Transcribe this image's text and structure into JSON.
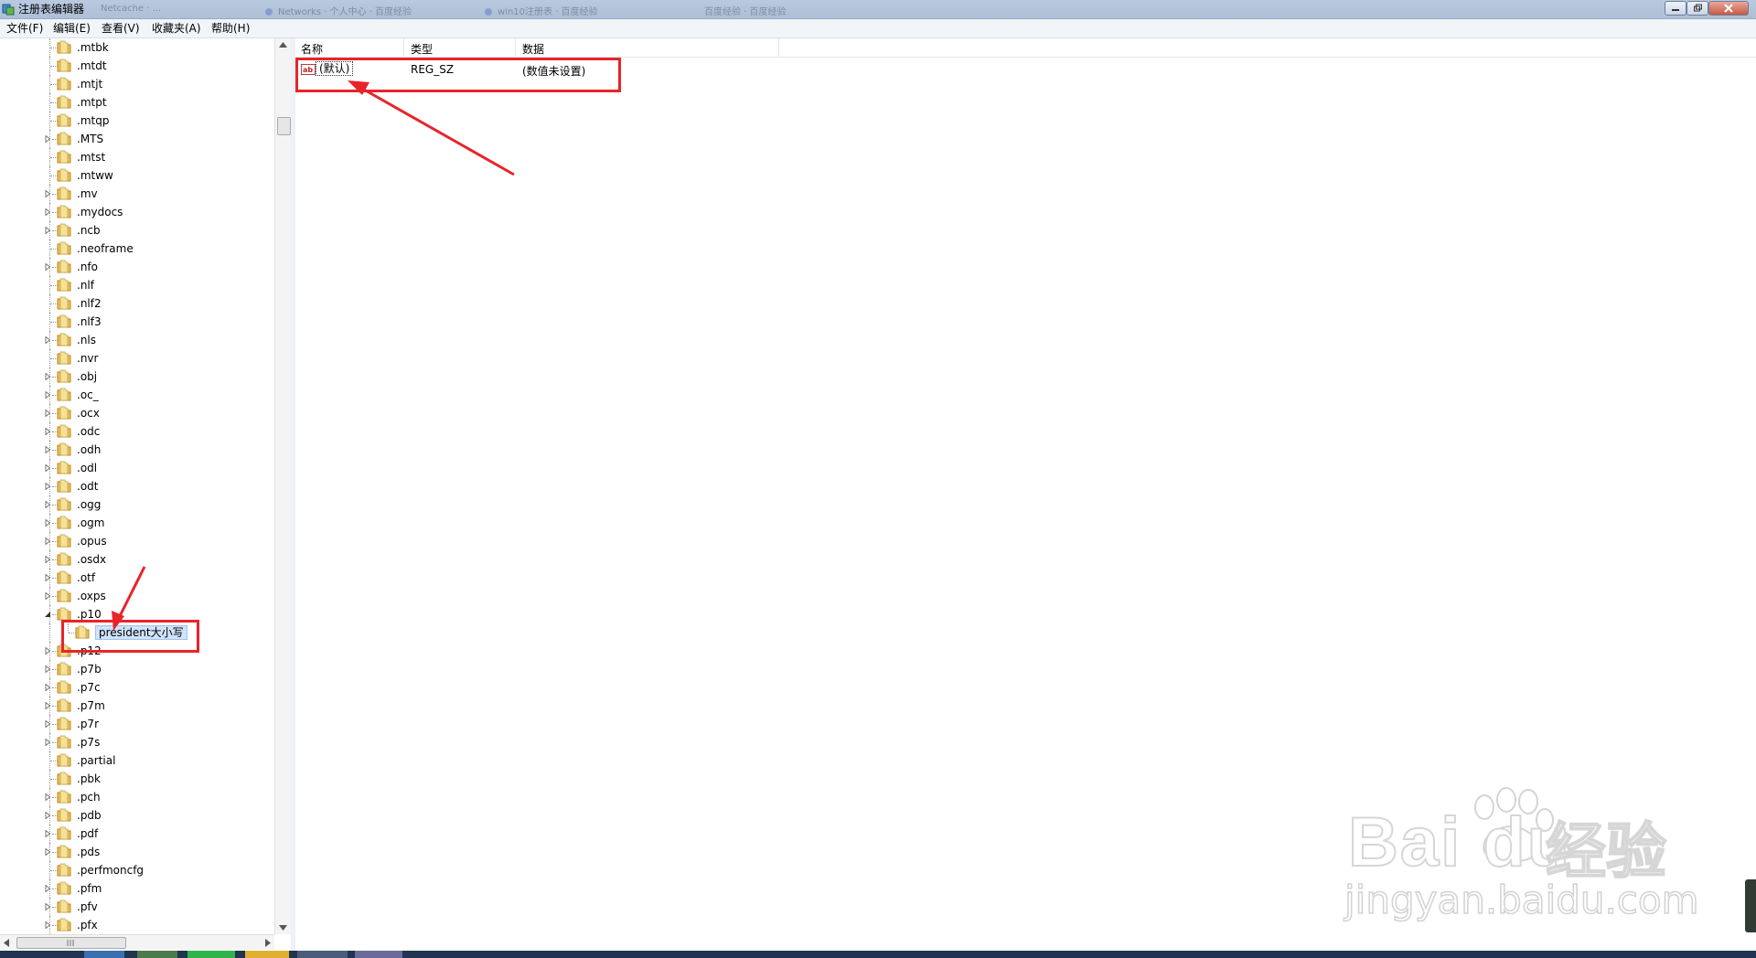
{
  "window": {
    "title": "注册表编辑器",
    "background_tabs": [
      "Netcache · ...",
      "Networks · 个人中心 · 百度经验",
      "win10注册表 · 百度经验",
      "百度经验 · 百度经验"
    ]
  },
  "menu": [
    "文件(F)",
    "编辑(E)",
    "查看(V)",
    "收藏夹(A)",
    "帮助(H)"
  ],
  "tree": {
    "items": [
      {
        "label": ".mtbk",
        "expandable": false
      },
      {
        "label": ".mtdt",
        "expandable": false
      },
      {
        "label": ".mtjt",
        "expandable": false
      },
      {
        "label": ".mtpt",
        "expandable": false
      },
      {
        "label": ".mtqp",
        "expandable": false
      },
      {
        "label": ".MTS",
        "expandable": true
      },
      {
        "label": ".mtst",
        "expandable": false
      },
      {
        "label": ".mtww",
        "expandable": false
      },
      {
        "label": ".mv",
        "expandable": true
      },
      {
        "label": ".mydocs",
        "expandable": true
      },
      {
        "label": ".ncb",
        "expandable": true
      },
      {
        "label": ".neoframe",
        "expandable": false
      },
      {
        "label": ".nfo",
        "expandable": true
      },
      {
        "label": ".nlf",
        "expandable": false
      },
      {
        "label": ".nlf2",
        "expandable": false
      },
      {
        "label": ".nlf3",
        "expandable": false
      },
      {
        "label": ".nls",
        "expandable": true
      },
      {
        "label": ".nvr",
        "expandable": false
      },
      {
        "label": ".obj",
        "expandable": true
      },
      {
        "label": ".oc_",
        "expandable": true
      },
      {
        "label": ".ocx",
        "expandable": true
      },
      {
        "label": ".odc",
        "expandable": true
      },
      {
        "label": ".odh",
        "expandable": true
      },
      {
        "label": ".odl",
        "expandable": true
      },
      {
        "label": ".odt",
        "expandable": true
      },
      {
        "label": ".ogg",
        "expandable": true
      },
      {
        "label": ".ogm",
        "expandable": true
      },
      {
        "label": ".opus",
        "expandable": true
      },
      {
        "label": ".osdx",
        "expandable": true
      },
      {
        "label": ".otf",
        "expandable": true
      },
      {
        "label": ".oxps",
        "expandable": true
      },
      {
        "label": ".p10",
        "expandable": true,
        "expanded": true
      },
      {
        "label": "president大小写",
        "child": true,
        "selected": true
      },
      {
        "label": ".p12",
        "expandable": true
      },
      {
        "label": ".p7b",
        "expandable": true
      },
      {
        "label": ".p7c",
        "expandable": true
      },
      {
        "label": ".p7m",
        "expandable": true
      },
      {
        "label": ".p7r",
        "expandable": true
      },
      {
        "label": ".p7s",
        "expandable": true
      },
      {
        "label": ".partial",
        "expandable": false
      },
      {
        "label": ".pbk",
        "expandable": false
      },
      {
        "label": ".pch",
        "expandable": true
      },
      {
        "label": ".pdb",
        "expandable": true
      },
      {
        "label": ".pdf",
        "expandable": true
      },
      {
        "label": ".pds",
        "expandable": true
      },
      {
        "label": ".perfmoncfg",
        "expandable": false
      },
      {
        "label": ".pfm",
        "expandable": true
      },
      {
        "label": ".pfv",
        "expandable": true
      },
      {
        "label": ".pfx",
        "expandable": true
      }
    ]
  },
  "list": {
    "columns": [
      "名称",
      "类型",
      "数据"
    ],
    "rows": [
      {
        "name": "(默认)",
        "type": "REG_SZ",
        "data": "(数值未设置)"
      }
    ]
  },
  "watermark": {
    "brand_latin": "Bai du",
    "brand_cjk": "经验",
    "url": "jingyan.baidu.com"
  },
  "colors": {
    "annotation": "#e8242a",
    "folder": "#e8c25a",
    "selection": "#cfe3fb"
  }
}
